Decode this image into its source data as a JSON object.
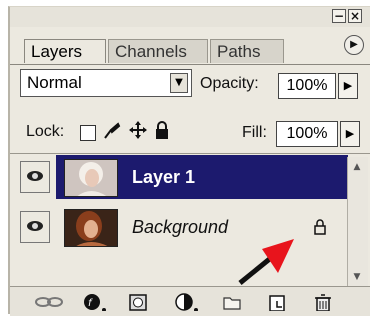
{
  "window": {
    "minimize_glyph": "−",
    "close_glyph": "×"
  },
  "tabs": [
    {
      "label": "Layers",
      "active": true
    },
    {
      "label": "Channels",
      "active": false
    },
    {
      "label": "Paths",
      "active": false
    }
  ],
  "panel_menu_icon": "flyout-arrow-icon",
  "blend_mode": {
    "value": "Normal"
  },
  "opacity": {
    "label": "Opacity:",
    "value": "100%"
  },
  "lock": {
    "label": "Lock:",
    "icons": [
      "lock-transparent-icon",
      "lock-brush-icon",
      "lock-move-icon",
      "lock-all-icon"
    ]
  },
  "fill": {
    "label": "Fill:",
    "value": "100%"
  },
  "layers": [
    {
      "name": "Layer 1",
      "selected": true,
      "visible": true
    },
    {
      "name": "Background",
      "selected": false,
      "visible": true,
      "locked": true
    }
  ],
  "bottom_icons": [
    "link-icon",
    "layer-style-icon",
    "mask-icon",
    "adjustment-icon",
    "group-folder-icon",
    "new-layer-icon",
    "trash-icon"
  ],
  "colors": {
    "selected_row": "#1c1a6e",
    "panel_bg": "#ece9e0",
    "arrow_red": "#e8141c"
  }
}
